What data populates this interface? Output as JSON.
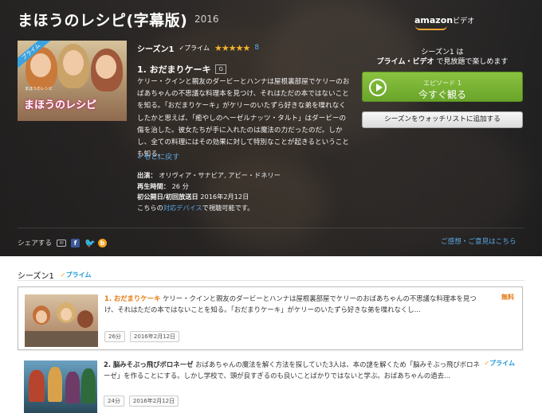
{
  "header": {
    "title": "まほうのレシピ(字幕版)",
    "year": "2016",
    "logo": {
      "brand": "amazon",
      "suffix": "ビデオ"
    }
  },
  "poster": {
    "ribbon": "プライム",
    "subtitle": "まほうのレシピ",
    "title": "まほうのレシピ"
  },
  "series": {
    "season": "シーズン1",
    "prime_label": "プライム",
    "stars": "★★★★★",
    "rating_count": "8"
  },
  "episode": {
    "title": "1. おだまりケーキ",
    "rating_badge": "G",
    "synopsis": "ケリー・クインと親友のダービーとハンナは屋根裏部屋でケリーのおばあちゃんの不思議な料理本を見つけ、それはただの本ではないことを知る。「おだまりケーキ」がケリーのいたずら好きな弟を喋れなくしたかと思えば、「癒やしのヘーゼルナッツ・タルト」はダービーの傷を治した。彼女たちが手に入れたのは魔法の力だったのだ。しかし、全ての料理にはその効果に対して特別なことが起きるということも知る。",
    "back_link": "« もとに戻す",
    "cast_label": "出演：",
    "cast": "オリヴィア・サナビア, アビー・ドネリー",
    "runtime_label": "再生時間：",
    "runtime": "26 分",
    "release_label": "初公開日/初回放送日",
    "release": "2016年2月12日",
    "devices_prefix": "こちらの",
    "devices_link": "対応デバイス",
    "devices_suffix": "で視聴可能です。"
  },
  "sidebar": {
    "head_line1": "シーズン1 は",
    "head_bold": "プライム・ビデオ",
    "head_line2": " で見放題で楽しめます",
    "watch_small": "エピソード 1",
    "watch_main": "今すぐ観る",
    "watchlist": "シーズンをウォッチリストに追加する"
  },
  "share": {
    "label": "シェアする",
    "icons": [
      "mail-icon",
      "facebook-icon",
      "twitter-icon",
      "blog-icon"
    ],
    "feedback": "ご感想・ご意見はこちら"
  },
  "season_list": {
    "label": "シーズン1",
    "prime_label": "プライム",
    "episodes": [
      {
        "name": "1. おだまりケーキ",
        "desc": "ケリー・クインと親友のダービーとハンナは屋根裏部屋でケリーのおばあちゃんの不思議な料理本を見つけ、それはただの本ではないことを知る。「おだまりケーキ」がケリーのいたずら好きな弟を喋れなくし...",
        "duration": "26分",
        "date": "2016年2月12日",
        "tag": "無料"
      },
      {
        "name": "2. 脳みそぶっ飛びボロネーゼ",
        "desc": "おばあちゃんの魔法を解く方法を探していた3人は、本の謎を解くため「脳みそぶっ飛びボロネーゼ」を作ることにする。しかし学校で、頭が良すぎるのも良いことばかりではないと学ぶ。おばあちゃんの過去...",
        "duration": "24分",
        "date": "2016年2月12日",
        "tag": "プライム"
      }
    ]
  },
  "colors": {
    "accent_blue": "#5aa9e6",
    "green_button": "#7cb342",
    "prime_orange": "#f4a21b",
    "title_orange": "#e47911"
  }
}
